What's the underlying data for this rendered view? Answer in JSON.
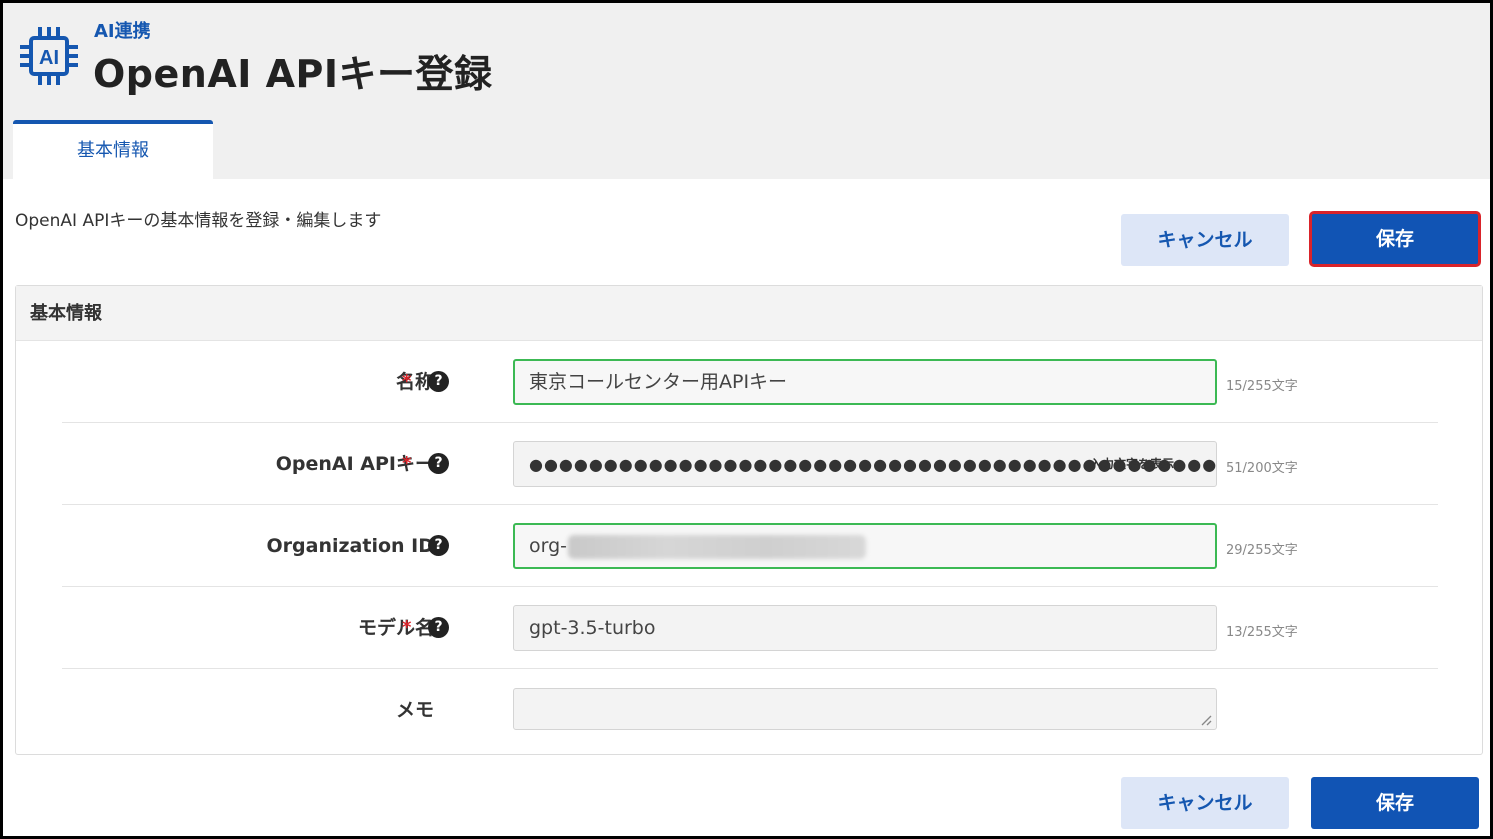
{
  "header": {
    "breadcrumb": "AI連携",
    "title": "OpenAI APIキー登録",
    "icon": "ai-chip-icon",
    "accent_color": "#1557b0"
  },
  "tabs": [
    {
      "label": "基本情報",
      "active": true
    }
  ],
  "description": "OpenAI APIキーの基本情報を登録・編集します",
  "actions": {
    "cancel_label": "キャンセル",
    "save_label": "保存"
  },
  "panel": {
    "title": "基本情報"
  },
  "form": {
    "name": {
      "label": "名称",
      "required": "*",
      "help": "?",
      "value": "東京コールセンター用APIキー",
      "counter": "15/255文字"
    },
    "api_key": {
      "label": "OpenAI APIキー",
      "required": "*",
      "help": "?",
      "value": "●●●●●●●●●●●●●●●●●●●●●●●●●●●●●●●●●●●●●●●●●●●●●●●●●●●",
      "reveal_label": "入力文字を表示",
      "counter": "51/200文字"
    },
    "org_id": {
      "label": "Organization ID",
      "help": "?",
      "value": "org-",
      "counter": "29/255文字"
    },
    "model": {
      "label": "モデル名",
      "required": "*",
      "help": "?",
      "value": "gpt-3.5-turbo",
      "counter": "13/255文字"
    },
    "memo": {
      "label": "メモ",
      "value": ""
    }
  },
  "colors": {
    "save_button": "#1154b4",
    "cancel_button": "#dde6f7",
    "required_mark": "#d9232a",
    "focus_border": "#3cb954",
    "highlight": "#d9232a"
  }
}
